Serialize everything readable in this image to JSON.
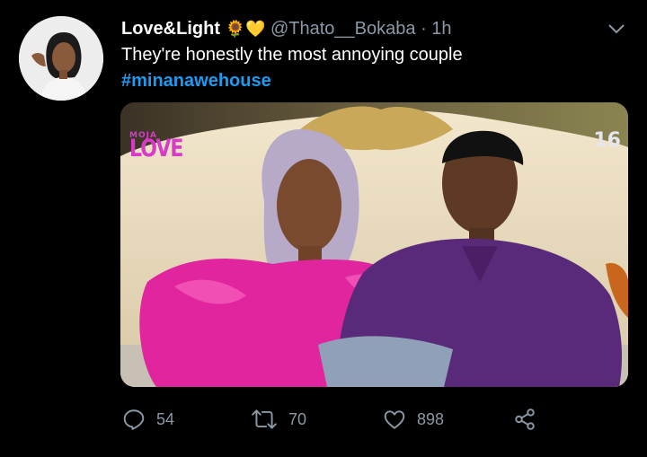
{
  "tweet": {
    "display_name": "Love&Light",
    "emojis": [
      "🌻",
      "💛"
    ],
    "handle": "@Thato__Bokaba",
    "separator": "·",
    "time": "1h",
    "text": "They're honestly the most annoying couple",
    "hashtag": "#minanawehouse"
  },
  "media": {
    "channel_logo_top": "MOJA",
    "channel_logo_bottom": "LOVE",
    "age_rating": "16"
  },
  "actions": {
    "replies": "54",
    "retweets": "70",
    "likes": "898"
  },
  "colors": {
    "background": "#000000",
    "link": "#1d9bf0",
    "secondary_text": "#8b98a5"
  }
}
